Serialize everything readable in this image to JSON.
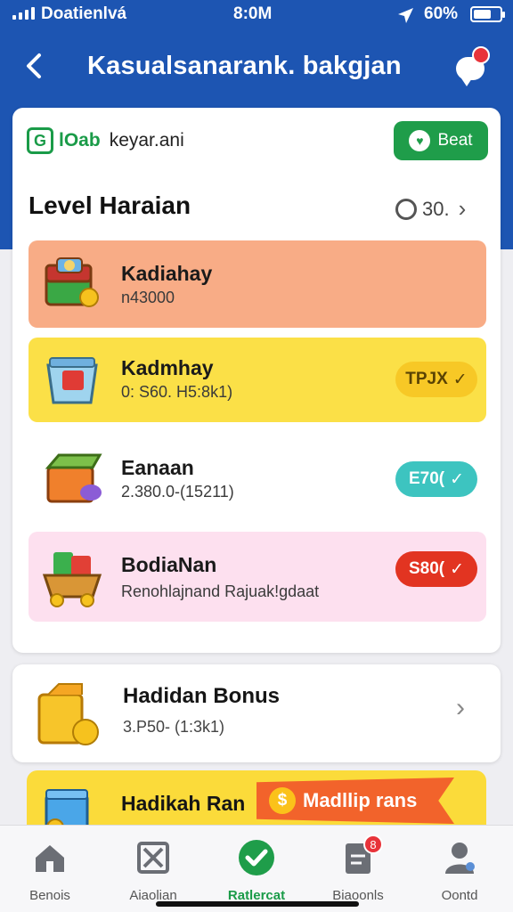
{
  "status_bar": {
    "carrier": "Doatienlvá",
    "time": "8:0M",
    "battery": "60%",
    "battery_level": 0.6
  },
  "header": {
    "title": "Kasualsanarank. bakgjan"
  },
  "brand": {
    "logo_letter": "G",
    "name": "lOab",
    "subtitle": "keyar.ani",
    "action_label": "Beat"
  },
  "level": {
    "title": "Level Haraian",
    "count": "30."
  },
  "tiers": [
    {
      "name": "Kadiahay",
      "desc": "n43000",
      "pill": "",
      "bg": "#f8ac86"
    },
    {
      "name": "Kadmhay",
      "desc": "0: S60. H5:8k1)",
      "pill": "TPJX",
      "bg": "#fbe047"
    },
    {
      "name": "Eanaan",
      "desc": "2.380.0-(15211)",
      "pill": "E70(",
      "bg": "#ffffff"
    },
    {
      "name": "BodiaNan",
      "desc": "Renohlajnand Rajuak!gdaat",
      "pill": "S80(",
      "bg": "#fde0ef"
    }
  ],
  "bonus": {
    "title": "Hadidan Bonus",
    "desc": "3.P50- (1:3k1)"
  },
  "promo": {
    "title": "Hadikah Ran",
    "badge": "Madllip rans",
    "badge_symbol": "$"
  },
  "nav": {
    "items": [
      {
        "label": "Benois",
        "icon": "home-icon"
      },
      {
        "label": "Aiaolian",
        "icon": "scissors-icon"
      },
      {
        "label": "Ratlercat",
        "icon": "check-circle-icon",
        "active": true
      },
      {
        "label": "Biaoonls",
        "icon": "clipboard-icon",
        "badge": "8"
      },
      {
        "label": "Oontd",
        "icon": "profile-icon"
      }
    ]
  },
  "colors": {
    "header_blue": "#1d55b2",
    "brand_green": "#1f9d4a",
    "alert_red": "#e8333a"
  }
}
